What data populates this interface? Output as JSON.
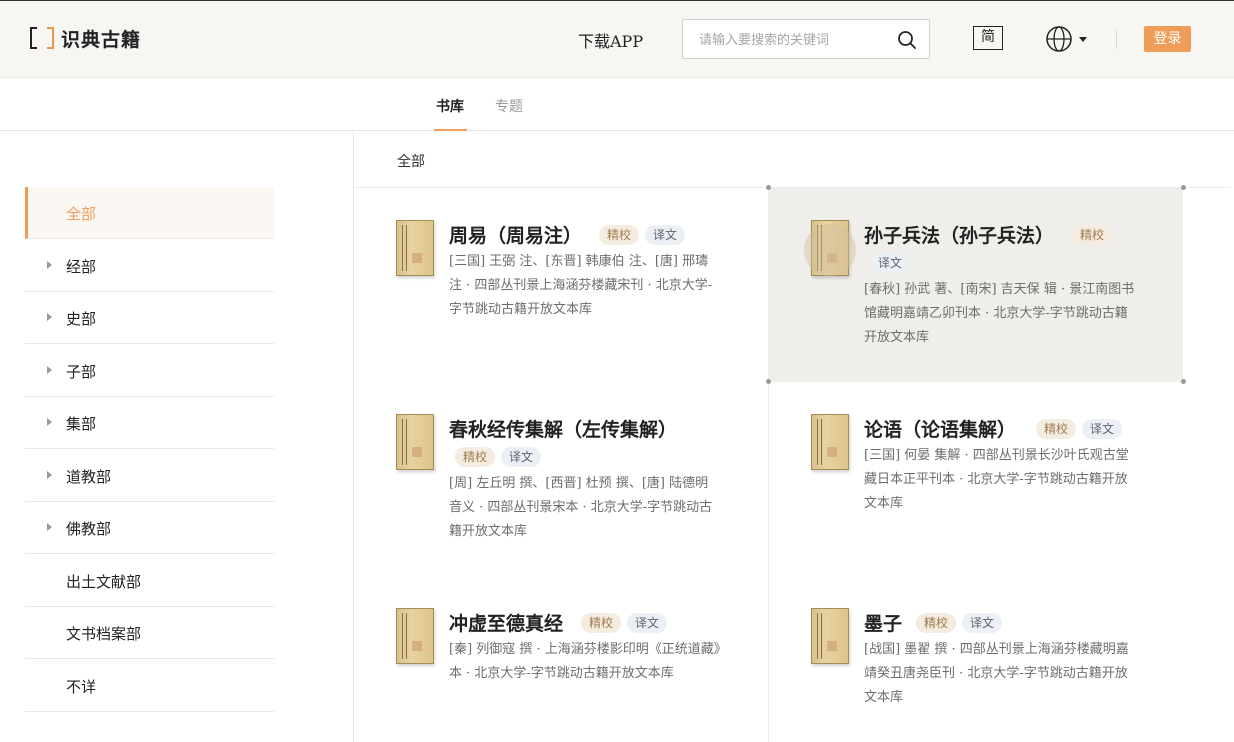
{
  "header": {
    "logo_text": "识典古籍",
    "download_label": "下载APP",
    "search_placeholder": "请输入要搜索的关键词",
    "simplified_label": "简",
    "login_label": "登录",
    "accent_color": "#ef9d58"
  },
  "tabs": [
    {
      "label": "书库",
      "active": true
    },
    {
      "label": "专题",
      "active": false
    }
  ],
  "sidebar": {
    "items": [
      {
        "label": "全部",
        "active": true,
        "expandable": false
      },
      {
        "label": "经部",
        "expandable": true
      },
      {
        "label": "史部",
        "expandable": true
      },
      {
        "label": "子部",
        "expandable": true
      },
      {
        "label": "集部",
        "expandable": true
      },
      {
        "label": "道教部",
        "expandable": true
      },
      {
        "label": "佛教部",
        "expandable": true
      },
      {
        "label": "出土文献部",
        "expandable": false
      },
      {
        "label": "文书档案部",
        "expandable": false
      },
      {
        "label": "不详",
        "expandable": false
      }
    ]
  },
  "breadcrumb": "全部",
  "books": [
    {
      "title": "周易（周易注）",
      "badge1": "精校",
      "badge2": "译文",
      "desc": "[三国] 王弼 注、[东晋] 韩康伯 注、[唐] 邢璹 注 · 四部丛刊景上海涵芬楼藏宋刊 · 北京大学-字节跳动古籍开放文本库"
    },
    {
      "title": "孙子兵法（孙子兵法）",
      "badge1": "精校",
      "badge2": "译文",
      "desc": "[春秋] 孙武 著、[南宋] 吉天保 辑 · 景江南图书馆藏明嘉靖乙卯刊本 · 北京大学-字节跳动古籍开放文本库"
    },
    {
      "title": "春秋经传集解（左传集解）",
      "badge1": "精校",
      "badge2": "译文",
      "desc": "[周] 左丘明 撰、[西晋] 杜预 撰、[唐] 陆德明 音义 · 四部丛刊景宋本 · 北京大学-字节跳动古籍开放文本库"
    },
    {
      "title": "论语（论语集解）",
      "badge1": "精校",
      "badge2": "译文",
      "desc": "[三国] 何晏 集解 · 四部丛刊景长沙叶氏观古堂藏日本正平刊本 · 北京大学-字节跳动古籍开放文本库"
    },
    {
      "title": "冲虚至德真经",
      "badge1": "精校",
      "badge2": "译文",
      "desc": "[秦] 列御寇 撰 · 上海涵芬楼影印明《正统道藏》本 · 北京大学-字节跳动古籍开放文本库"
    },
    {
      "title": "墨子",
      "badge1": "精校",
      "badge2": "译文",
      "desc": "[战国] 墨翟 撰 · 四部丛刊景上海涵芬楼藏明嘉靖癸丑唐尧臣刊 · 北京大学-字节跳动古籍开放文本库"
    }
  ]
}
